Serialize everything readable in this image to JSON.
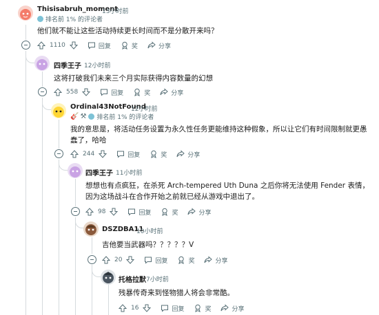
{
  "comments": [
    {
      "username": "Thisisabruh_moment",
      "time": "13小时前",
      "badge": "排名前 1% 的评论者",
      "text": "他们就不能让这些活动持续更长时间而不是分散开来吗？",
      "votes": "1110",
      "reply": "回复",
      "award": "奖",
      "share": "分享",
      "avatar_color": "#f47c6a"
    },
    {
      "username": "四季王子",
      "time": "12小时前",
      "text": "这将打破我们未来三个月实际获得内容数量的幻想",
      "votes": "558",
      "reply": "回复",
      "award": "奖",
      "share": "分享",
      "avatar_color": "#d4b3ea"
    },
    {
      "username": "Ordinal43NotFound",
      "time": "12小时前",
      "badge": "排名前 1% 的评论者",
      "text": "我的意思是，将活动任务设置为永久性任务更能维持这种假象，所以让它们有时间限制就更愚蠢了，哈哈",
      "votes": "244",
      "reply": "回复",
      "award": "奖",
      "share": "分享",
      "avatar_color": "#ffd635"
    },
    {
      "username": "四季王子",
      "time": "11小时前",
      "text": "想想也有点疯狂，在杀死 Arch-tempered Uth Duna 之后你将无法使用 Fender 表情，因为这场战斗在合作开始之前就已经从游戏中退出了。",
      "votes": "98",
      "reply": "回复",
      "award": "奖",
      "share": "分享",
      "avatar_color": "#d4b3ea"
    },
    {
      "username": "DSZDBA11",
      "time": "10小时前",
      "text": "吉他要当武器吗？？？？？V",
      "votes": "20",
      "reply": "回复",
      "award": "奖",
      "share": "分享",
      "avatar_color": "#8b5a3c"
    },
    {
      "username": "托格拉默",
      "time": "7小时前",
      "text": "残暴传奇来到怪物猎人将会非常酷。",
      "votes": "16",
      "reply": "回复",
      "award": "奖",
      "share": "分享",
      "avatar_color": "#4a5560"
    }
  ]
}
